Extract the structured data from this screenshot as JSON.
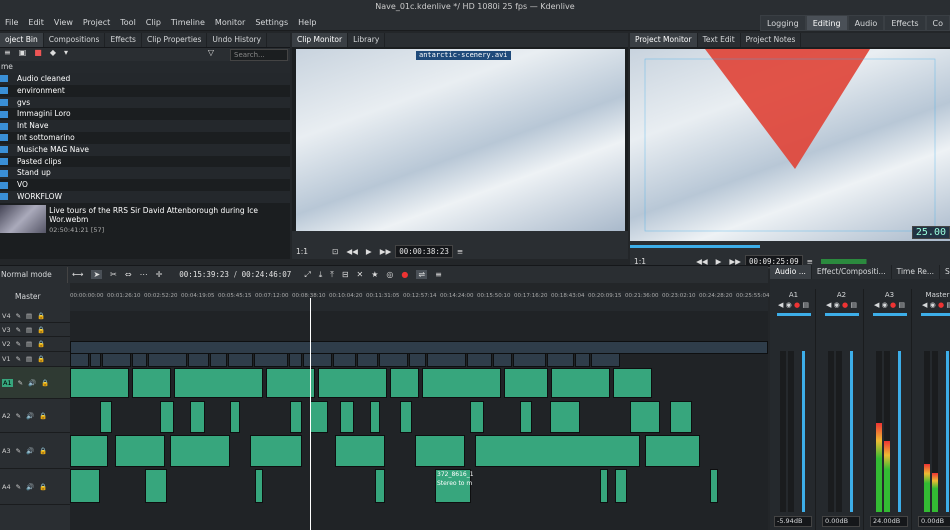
{
  "window": {
    "title": "Nave_01c.kdenlive */ HD 1080i 25 fps — Kdenlive"
  },
  "menu": [
    "File",
    "Edit",
    "View",
    "Project",
    "Tool",
    "Clip",
    "Timeline",
    "Monitor",
    "Settings",
    "Help"
  ],
  "workspaces": [
    "Logging",
    "Editing",
    "Audio",
    "Effects",
    "Co"
  ],
  "bin": {
    "tabs": [
      "oject Bin",
      "Compositions",
      "Effects",
      "Clip Properties",
      "Undo History"
    ],
    "search_placeholder": "Search...",
    "column": "me",
    "folders": [
      "Audio cleaned",
      "environment",
      "gvs",
      "Immagini Loro",
      "Int Nave",
      "Int sottomarino",
      "Musiche MAG Nave",
      "Pasted clips",
      "Stand up",
      "VO",
      "WORKFLOW"
    ],
    "clip": {
      "name": "Live tours of the RRS Sir David Attenborough during Ice Wor.webm",
      "meta": "02:50:41:21 [57]"
    }
  },
  "clip_monitor": {
    "tabs": [
      "Clip Monitor",
      "Library"
    ],
    "clip_name": "antarctic-scenery.avi",
    "timecode": "00:00:38:23",
    "zoom": "1:1"
  },
  "project_monitor": {
    "tabs": [
      "Project Monitor",
      "Text Edit",
      "Project Notes"
    ],
    "timecode": "00:09:25:09",
    "overlay": "25.00",
    "zoom": "1:1"
  },
  "timeline": {
    "mode": "Normal mode",
    "position": "00:15:39:23",
    "duration": "00:24:46:07",
    "master": "Master",
    "ruler": [
      "00:00:00:00",
      "00:01:26:10",
      "00:02:52:20",
      "00:04:19:05",
      "00:05:45:15",
      "00:07:12:00",
      "00:08:38:10",
      "00:10:04:20",
      "00:11:31:05",
      "00:12:57:14",
      "00:14:24:00",
      "00:15:50:10",
      "00:17:16:20",
      "00:18:43:04",
      "00:20:09:15",
      "00:21:36:00",
      "00:23:02:10",
      "00:24:28:20",
      "00:25:55:04"
    ],
    "tracks": [
      "V4",
      "V3",
      "V2",
      "V1",
      "A1",
      "A2",
      "A3",
      "A4"
    ],
    "clip_label": "372_8616_1",
    "clip_label2": "Stereo to m"
  },
  "mixer": {
    "tabs": [
      "Audio ...",
      "Effect/Compositi...",
      "Time Re...",
      "Subti"
    ],
    "channels": [
      {
        "name": "A1",
        "db": "-5.94dB",
        "level": 0.0
      },
      {
        "name": "A2",
        "db": "0.00dB",
        "level": 0.0
      },
      {
        "name": "A3",
        "db": "24.00dB",
        "level": 0.55
      },
      {
        "name": "Master",
        "db": "0.00dB",
        "level": 0.3
      }
    ]
  },
  "colors": {
    "accent": "#3daee9",
    "audio_clip": "#37a67d",
    "video_clip": "#2f3d4a",
    "folder": "#3a8fd6"
  }
}
